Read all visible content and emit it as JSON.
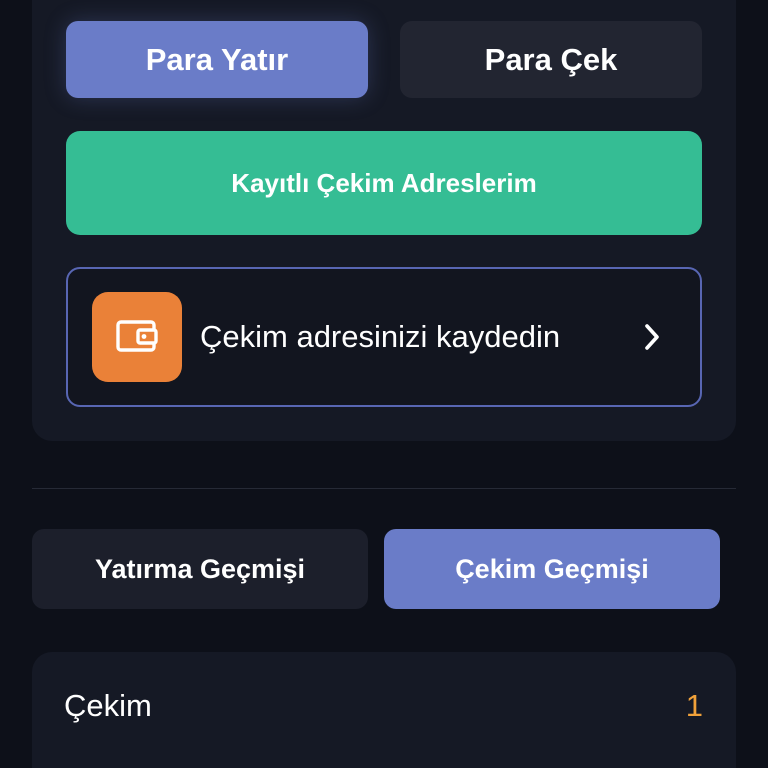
{
  "wallet": {
    "deposit_label": "Para Yatır",
    "withdraw_label": "Para Çek",
    "saved_addresses_label": "Kayıtlı Çekim Adreslerim",
    "save_address_prompt": "Çekim adresinizi kaydedin"
  },
  "history": {
    "tabs": [
      {
        "label": "Yatırma Geçmişi",
        "active": false
      },
      {
        "label": "Çekim Geçmişi",
        "active": true
      }
    ],
    "rows": [
      {
        "label": "Çekim",
        "count": "1"
      }
    ]
  },
  "colors": {
    "background": "#0d1019",
    "card": "#151925",
    "accent": "#6a7cc8",
    "success": "#35bd94",
    "wallet_icon_bg": "#ea8138",
    "count": "#f0a13a"
  },
  "icons": {
    "wallet": "wallet-icon",
    "chevron": "chevron-right-icon"
  }
}
